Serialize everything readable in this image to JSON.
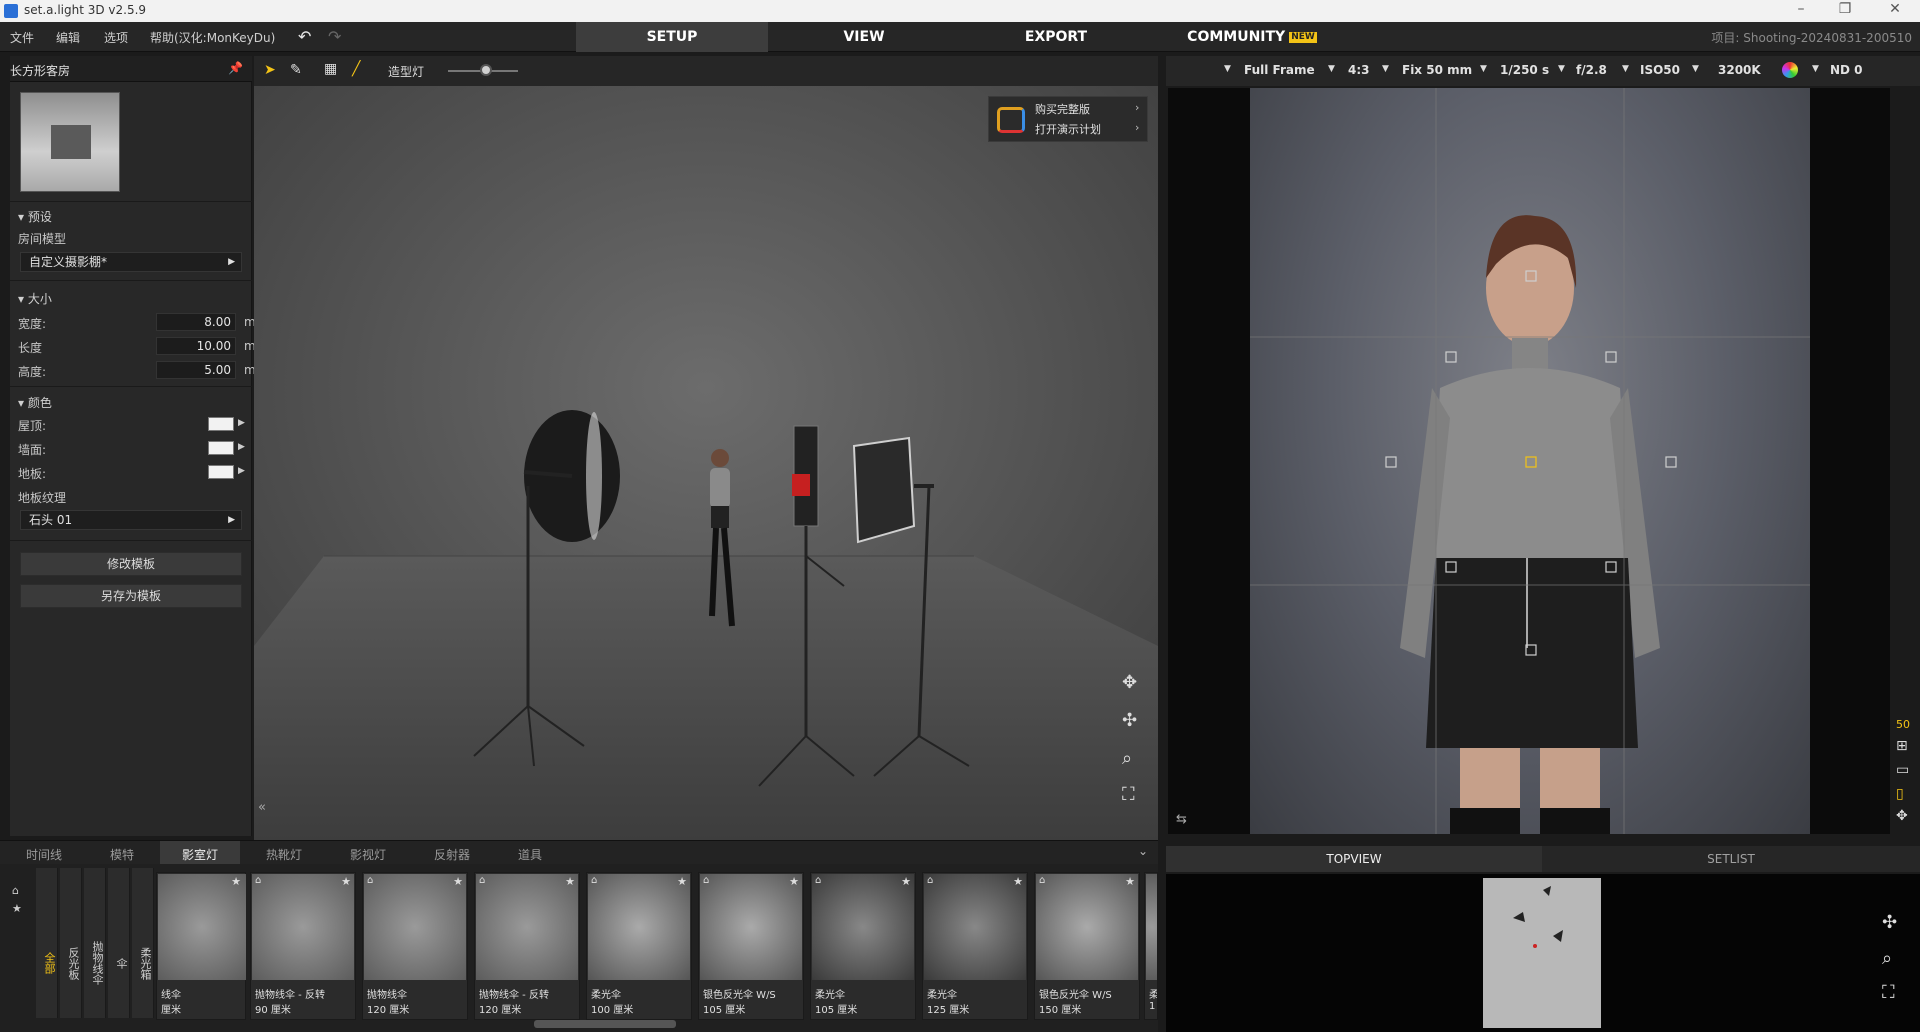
{
  "window": {
    "title": "set.a.light 3D v2.5.9",
    "controls": [
      "–",
      "❐",
      "✕"
    ]
  },
  "menu": {
    "items": [
      "文件",
      "编辑",
      "选项",
      "帮助(汉化:MonKeyDu)"
    ]
  },
  "nav": {
    "tabs": [
      "SETUP",
      "VIEW",
      "EXPORT",
      "COMMUNITY"
    ],
    "new_badge": "NEW",
    "active": "SETUP"
  },
  "project": "项目: Shooting-20240831-200510",
  "left_panel": {
    "title": "长方形客房",
    "preset_section": "预设",
    "room_model_label": "房间模型",
    "room_model_value": "自定义摄影棚*",
    "size_section": "大小",
    "width_label": "宽度:",
    "width_value": "8.00",
    "length_label": "长度",
    "length_value": "10.00",
    "height_label": "高度:",
    "height_value": "5.00",
    "unit": "m",
    "color_section": "颜色",
    "ceiling_label": "屋顶:",
    "wall_label": "墙面:",
    "floor_label": "地板:",
    "floor_texture_label": "地板纹理",
    "floor_texture_value": "石头 01",
    "edit_template": "修改模板",
    "save_template": "另存为模板"
  },
  "viewport_toolbar": {
    "modeling_light": "造型灯"
  },
  "promo": {
    "buy": "购买完整版",
    "demo": "打开演示计划"
  },
  "camera": {
    "format": "Full Frame",
    "aspect": "4:3",
    "lens": "Fix 50 mm",
    "shutter": "1/250 s",
    "aperture": "f/2.8",
    "iso": "ISO50",
    "wb": "3200K",
    "nd": "ND 0",
    "focal_indicator": "50"
  },
  "bottom_right": {
    "tabs": [
      "TOPVIEW",
      "SETLIST"
    ]
  },
  "library": {
    "tabs": [
      "时间线",
      "模特",
      "影室灯",
      "热靴灯",
      "影视灯",
      "反射器",
      "道具"
    ],
    "active_tab": "影室灯",
    "categories": [
      "全部",
      "反光板",
      "抛物线伞",
      "伞",
      "柔光箱"
    ],
    "items": [
      {
        "l1": "线伞",
        "l2": "厘米"
      },
      {
        "l1": "抛物线伞 - 反转",
        "l2": "90 厘米"
      },
      {
        "l1": "抛物线伞",
        "l2": "120 厘米"
      },
      {
        "l1": "抛物线伞 - 反转",
        "l2": "120 厘米"
      },
      {
        "l1": "柔光伞",
        "l2": "100 厘米"
      },
      {
        "l1": "银色反光伞 W/S",
        "l2": "105 厘米"
      },
      {
        "l1": "柔光伞",
        "l2": "105 厘米"
      },
      {
        "l1": "柔光伞",
        "l2": "125 厘米"
      },
      {
        "l1": "银色反光伞 W/S",
        "l2": "150 厘米"
      },
      {
        "l1": "柔",
        "l2": "1"
      }
    ]
  }
}
